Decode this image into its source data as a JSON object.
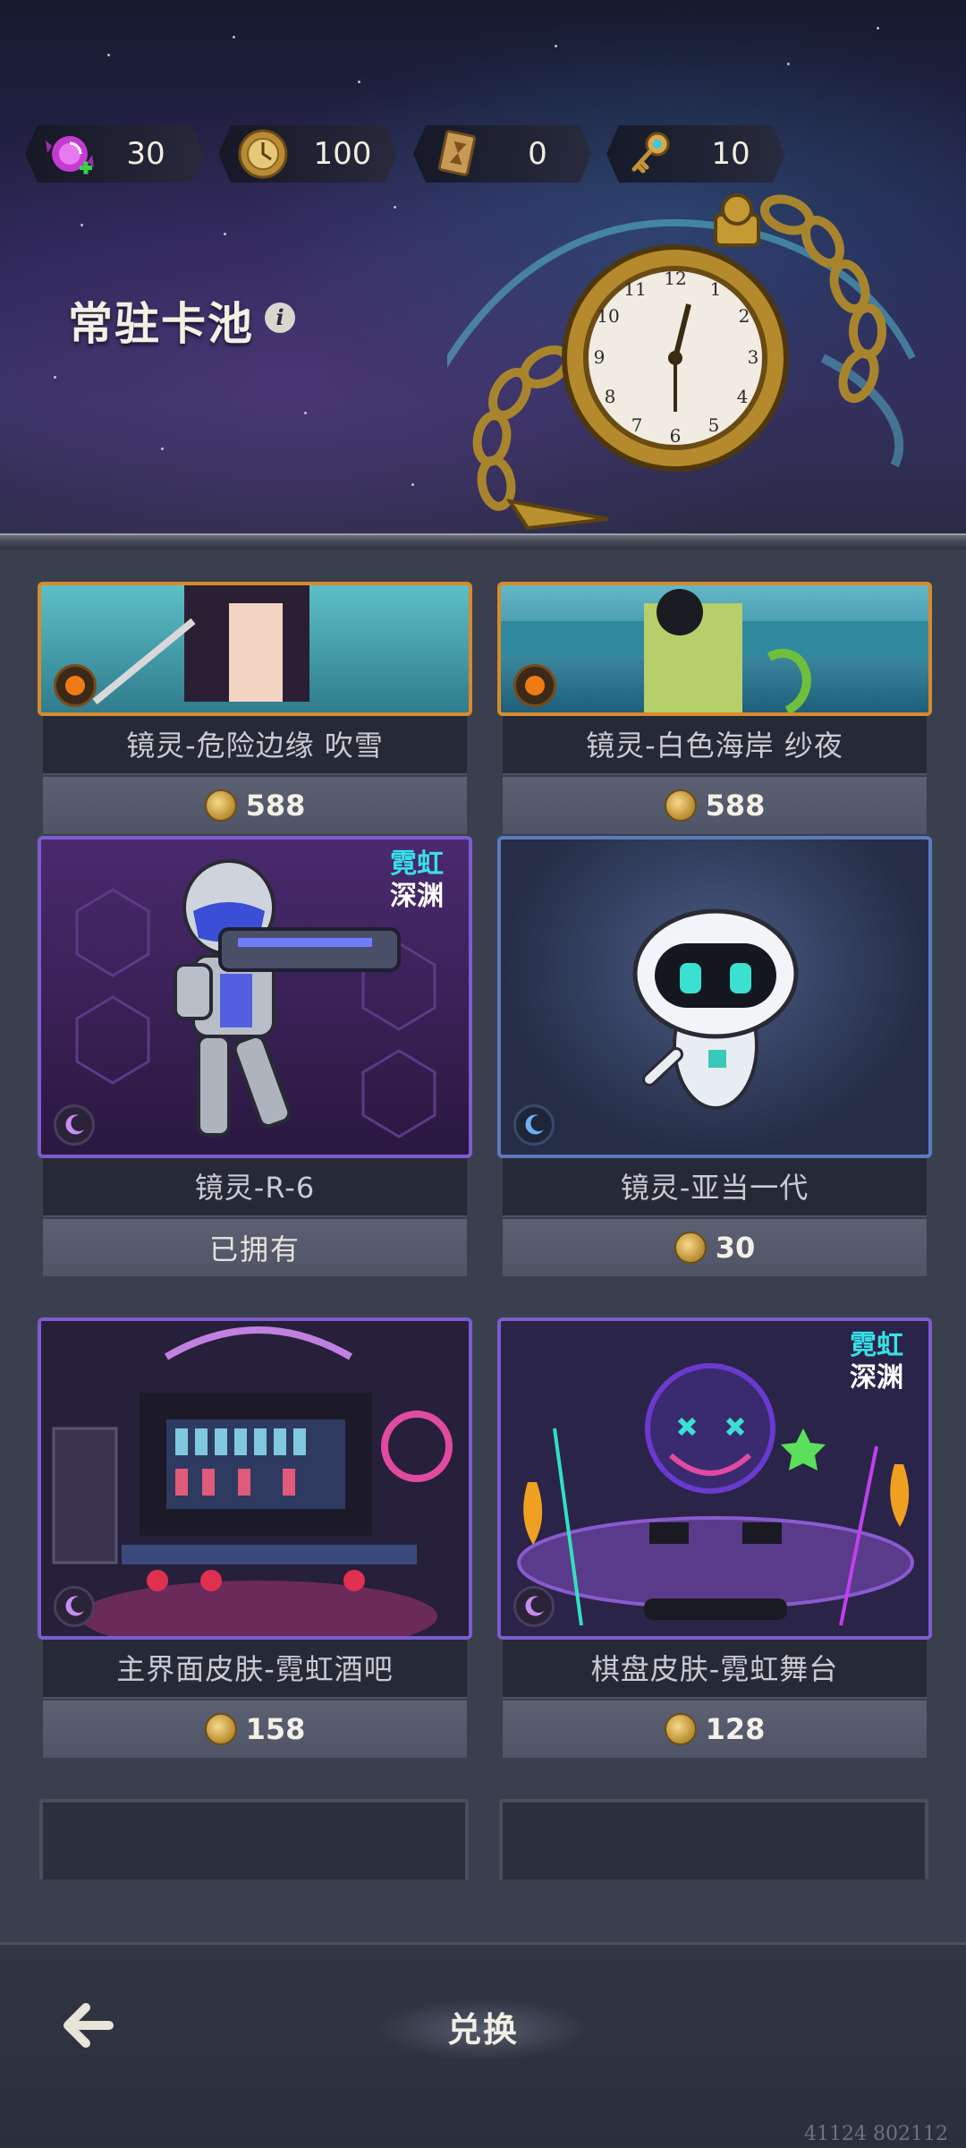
{
  "currencies": [
    {
      "name": "candy",
      "icon": "candy-icon",
      "value": "30",
      "has_add": true
    },
    {
      "name": "coin",
      "icon": "coin-icon",
      "value": "100"
    },
    {
      "name": "hourglass-card",
      "icon": "hourglass-card-icon",
      "value": "0"
    },
    {
      "name": "key",
      "icon": "key-icon",
      "value": "10"
    }
  ],
  "header": {
    "pool_title": "常驻卡池",
    "info_symbol": "i"
  },
  "cards": [
    {
      "name": "镜灵-危险边缘 吹雪",
      "price": "588",
      "owned": false,
      "rarity": "orange"
    },
    {
      "name": "镜灵-白色海岸 纱夜",
      "price": "588",
      "owned": false,
      "rarity": "orange"
    },
    {
      "name": "镜灵-R-6",
      "status": "已拥有",
      "owned": true,
      "rarity": "purple",
      "badge": [
        "霓虹",
        "深渊"
      ]
    },
    {
      "name": "镜灵-亚当一代",
      "price": "30",
      "owned": false,
      "rarity": "blue"
    },
    {
      "name": "主界面皮肤-霓虹酒吧",
      "price": "158",
      "owned": false,
      "rarity": "purple"
    },
    {
      "name": "棋盘皮肤-霓虹舞台",
      "price": "128",
      "owned": false,
      "rarity": "purple",
      "badge": [
        "霓虹",
        "深渊"
      ]
    }
  ],
  "bottom": {
    "back_icon": "back-arrow-icon",
    "exchange_label": "兑换"
  },
  "build_id": "41124 802112",
  "colors": {
    "purple_frame": "#7e5ccf",
    "blue_frame": "#5b7bbf",
    "orange_frame": "#d88a2c",
    "price_bar": "#555a6c"
  }
}
